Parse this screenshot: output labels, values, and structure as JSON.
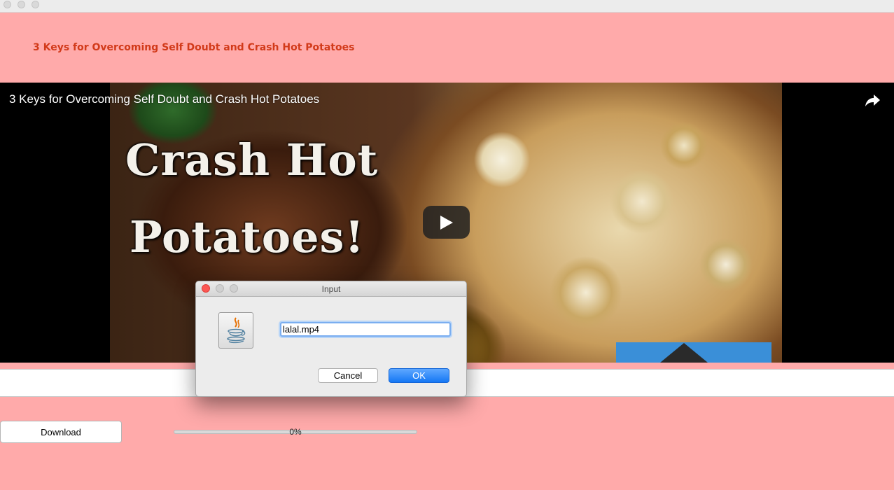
{
  "window": {
    "title": ""
  },
  "header": {
    "title": "3 Keys for Overcoming Self Doubt and Crash Hot Potatoes"
  },
  "video": {
    "title": "3 Keys for Overcoming Self Doubt and Crash Hot Potatoes",
    "thumbnail_text_line1": "Crash Hot",
    "thumbnail_text_line2": "Potatoes!",
    "icons": {
      "share": "share-icon",
      "play": "play-icon"
    }
  },
  "controls": {
    "download_label": "Download",
    "progress_percent": 0,
    "progress_label": "0%"
  },
  "dialog": {
    "title": "Input",
    "input_value": "lalal.mp4",
    "cancel_label": "Cancel",
    "ok_label": "OK",
    "icon": "java-icon"
  },
  "colors": {
    "background": "#ffaaaa",
    "header_title": "#d23a1a",
    "ok_button": "#1577f4",
    "close_light": "#fc5753"
  }
}
